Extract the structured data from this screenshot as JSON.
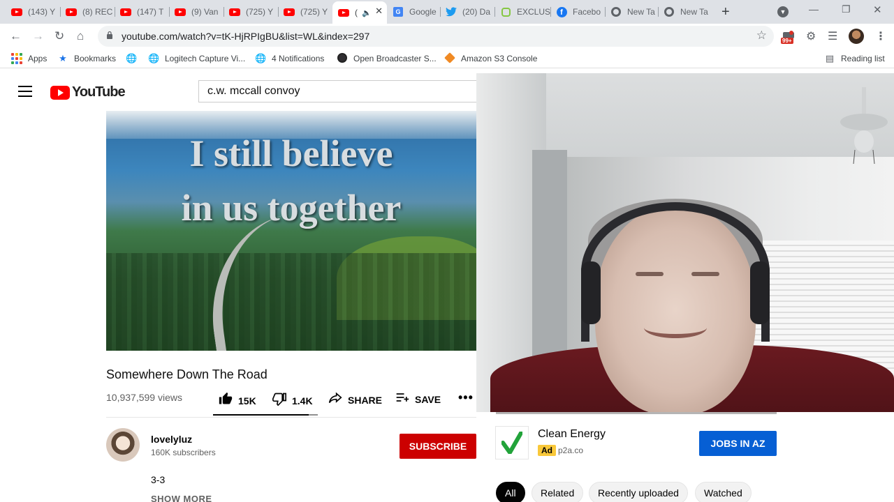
{
  "browser": {
    "tabs": [
      {
        "label": "(143) Y",
        "icon": "youtube"
      },
      {
        "label": "(8) REC",
        "icon": "youtube"
      },
      {
        "label": "(147) T",
        "icon": "youtube"
      },
      {
        "label": "(9) Van",
        "icon": "youtube"
      },
      {
        "label": "(725) Y",
        "icon": "youtube"
      },
      {
        "label": "(725) Y",
        "icon": "youtube"
      },
      {
        "label": "(",
        "icon": "youtube"
      },
      {
        "label": "Google",
        "icon": "google-translate"
      },
      {
        "label": "(20) Da",
        "icon": "twitter"
      },
      {
        "label": "EXCLUS",
        "icon": "rumble"
      },
      {
        "label": "Facebo",
        "icon": "facebook"
      },
      {
        "label": "New Ta",
        "icon": "chrome"
      },
      {
        "label": "New Ta",
        "icon": "chrome"
      }
    ],
    "active_tab_index": 6,
    "url": "youtube.com/watch?v=tK-HjRPIgBU&list=WL&index=297",
    "extension_badge": "99+",
    "bookmarks": [
      {
        "label": "Apps",
        "icon": "apps-grid"
      },
      {
        "label": "Bookmarks",
        "icon": "star"
      },
      {
        "label": "",
        "icon": "globe"
      },
      {
        "label": "Logitech Capture Vi...",
        "icon": "globe"
      },
      {
        "label": "4 Notifications",
        "icon": "globe"
      },
      {
        "label": "Open Broadcaster S...",
        "icon": "obs"
      },
      {
        "label": "Amazon S3 Console",
        "icon": "aws"
      }
    ],
    "reading_list": "Reading list"
  },
  "youtube": {
    "logo_text": "YouTube",
    "search_value": "c.w. mccall convoy",
    "video_caption_line1": "I still believe",
    "video_caption_line2": "in us together",
    "video_title": "Somewhere Down The Road",
    "views": "10,937,599 views",
    "like_count": "15K",
    "dislike_count": "1.4K",
    "like_ratio": 0.91,
    "share_label": "SHARE",
    "save_label": "SAVE",
    "more_label": "•••",
    "channel_name": "lovelyluz",
    "subscribers": "160K subscribers",
    "subscribe_label": "SUBSCRIBE",
    "description": "3-3",
    "show_more_label": "SHOW MORE"
  },
  "ad": {
    "title": "Clean Energy",
    "badge": "Ad",
    "domain": "p2a.co",
    "cta": "JOBS IN AZ"
  },
  "chips": [
    {
      "label": "All",
      "selected": true
    },
    {
      "label": "Related",
      "selected": false
    },
    {
      "label": "Recently uploaded",
      "selected": false
    },
    {
      "label": "Watched",
      "selected": false
    }
  ],
  "colors": {
    "youtube_red": "#ff0000",
    "subscribe_red": "#cc0000",
    "ad_cta_blue": "#065fd4",
    "ad_badge_yellow": "#f9c83a",
    "tabstrip_bg": "#dee1e6"
  }
}
